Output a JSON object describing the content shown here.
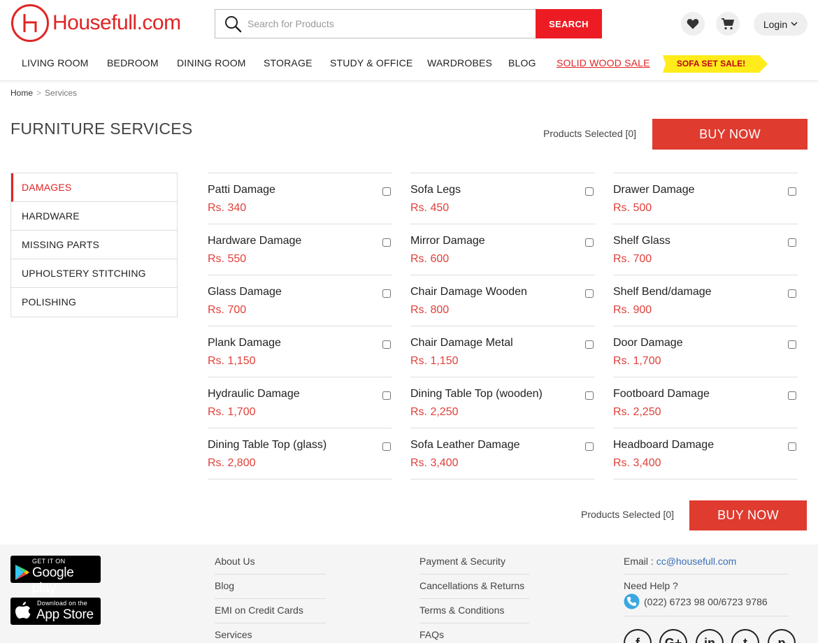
{
  "header": {
    "logo_text": "Housefull.com",
    "search_placeholder": "Search for Products",
    "search_button": "SEARCH",
    "login_label": "Login"
  },
  "nav": {
    "items": [
      "LIVING ROOM",
      "BEDROOM",
      "DINING ROOM",
      "STORAGE",
      "STUDY & OFFICE",
      "WARDROBES",
      "BLOG",
      "SOLID WOOD SALE"
    ],
    "badge": "SOFA SET SALE!"
  },
  "breadcrumb": {
    "home": "Home",
    "separator": ">",
    "current": "Services"
  },
  "page": {
    "title": "FURNITURE SERVICES",
    "selected_text": "Products Selected [0]",
    "buy_label": "BUY NOW"
  },
  "sidebar": {
    "items": [
      "DAMAGES",
      "HARDWARE",
      "MISSING PARTS",
      "UPHOLSTERY STITCHING",
      "POLISHING"
    ],
    "active": "DAMAGES"
  },
  "services": {
    "columns": [
      [
        {
          "name": "Patti Damage",
          "price": "Rs. 340"
        },
        {
          "name": "Hardware Damage",
          "price": "Rs. 550"
        },
        {
          "name": "Glass Damage",
          "price": "Rs. 700"
        },
        {
          "name": "Plank Damage",
          "price": "Rs. 1,150"
        },
        {
          "name": "Hydraulic Damage",
          "price": "Rs. 1,700"
        },
        {
          "name": "Dining Table Top (glass)",
          "price": "Rs. 2,800"
        }
      ],
      [
        {
          "name": "Sofa Legs",
          "price": "Rs. 450"
        },
        {
          "name": "Mirror Damage",
          "price": "Rs. 600"
        },
        {
          "name": "Chair Damage Wooden",
          "price": "Rs. 800"
        },
        {
          "name": "Chair Damage Metal",
          "price": "Rs. 1,150"
        },
        {
          "name": "Dining Table Top (wooden)",
          "price": "Rs. 2,250"
        },
        {
          "name": "Sofa Leather Damage",
          "price": "Rs. 3,400"
        }
      ],
      [
        {
          "name": "Drawer Damage",
          "price": "Rs. 500"
        },
        {
          "name": "Shelf Glass",
          "price": "Rs. 700"
        },
        {
          "name": "Shelf Bend/damage",
          "price": "Rs. 900"
        },
        {
          "name": "Door Damage",
          "price": "Rs. 1,700"
        },
        {
          "name": "Footboard Damage",
          "price": "Rs. 2,250"
        },
        {
          "name": "Headboard Damage",
          "price": "Rs. 3,400"
        }
      ]
    ]
  },
  "footer": {
    "google_play": {
      "small": "GET IT ON",
      "big": "Google play"
    },
    "app_store": {
      "small": "Download on the",
      "big": "App Store"
    },
    "links_col1": [
      "About Us",
      "Blog",
      "EMI on Credit Cards",
      "Services"
    ],
    "links_col2": [
      "Payment & Security",
      "Cancellations & Returns",
      "Terms & Conditions",
      "FAQs"
    ],
    "email_label": "Email : ",
    "email": "cc@housefull.com",
    "help_label": "Need Help ?",
    "phone": "(022) 6723 98 00/6723 9786",
    "social": [
      "f",
      "G+",
      "in",
      "t",
      "p"
    ]
  },
  "colors": {
    "brand": "#e02424",
    "buy": "#df3b2f",
    "price": "#e0403a",
    "badge": "#ffec1a"
  }
}
